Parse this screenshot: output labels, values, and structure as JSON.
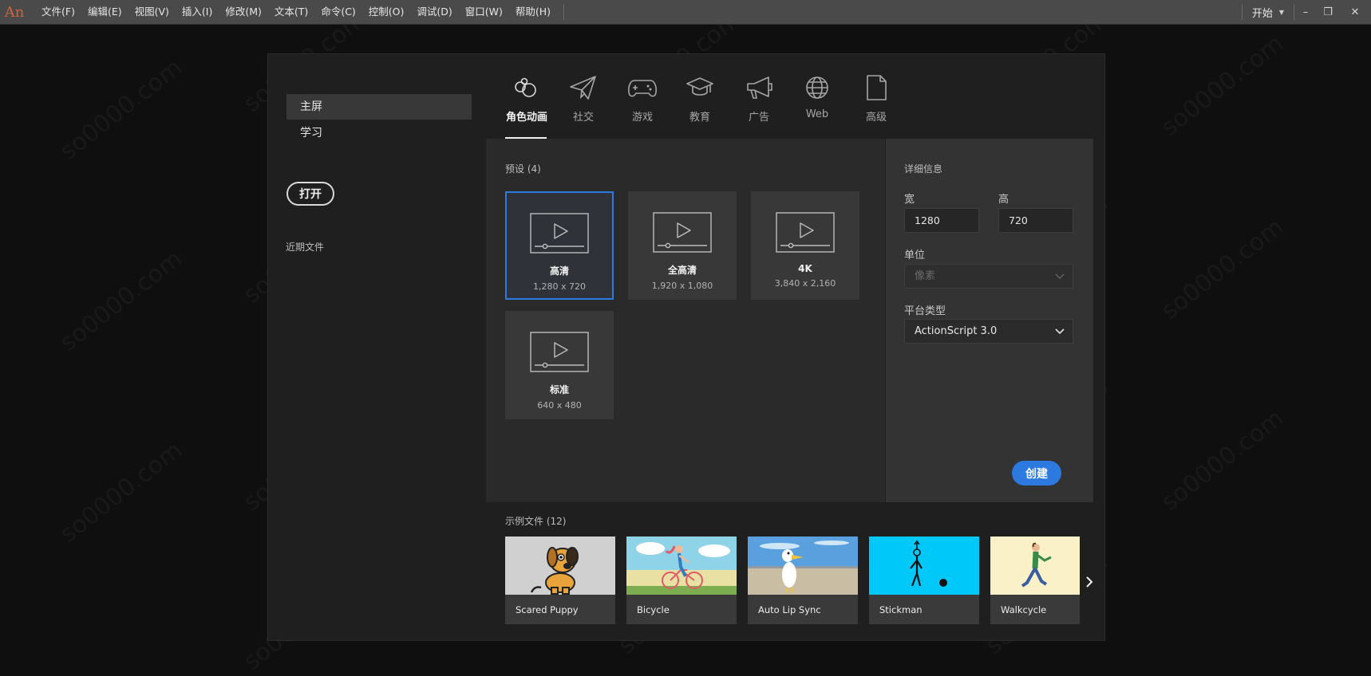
{
  "app": {
    "logo": "An",
    "menu": [
      "文件(F)",
      "编辑(E)",
      "视图(V)",
      "插入(I)",
      "修改(M)",
      "文本(T)",
      "命令(C)",
      "控制(O)",
      "调试(D)",
      "窗口(W)",
      "帮助(H)"
    ],
    "workspace": "开始",
    "window_controls": {
      "minimize": "–",
      "restore": "❐",
      "close": "✕"
    }
  },
  "sidebar": {
    "items": [
      {
        "label": "主屏",
        "active": true
      },
      {
        "label": "学习",
        "active": false
      }
    ],
    "open_button": "打开",
    "recent_title": "近期文件"
  },
  "categories": [
    {
      "label": "角色动画",
      "icon": "character-animation-icon",
      "active": true
    },
    {
      "label": "社交",
      "icon": "paper-plane-icon",
      "active": false
    },
    {
      "label": "游戏",
      "icon": "gamepad-icon",
      "active": false
    },
    {
      "label": "教育",
      "icon": "graduation-cap-icon",
      "active": false
    },
    {
      "label": "广告",
      "icon": "megaphone-icon",
      "active": false
    },
    {
      "label": "Web",
      "icon": "globe-icon",
      "active": false
    },
    {
      "label": "高级",
      "icon": "document-icon",
      "active": false
    }
  ],
  "presets": {
    "title": "预设 (4)",
    "items": [
      {
        "name": "高清",
        "size": "1,280 x 720",
        "selected": true
      },
      {
        "name": "全高清",
        "size": "1,920 x 1,080",
        "selected": false
      },
      {
        "name": "4K",
        "size": "3,840 x 2,160",
        "selected": false
      },
      {
        "name": "标准",
        "size": "640 x 480",
        "selected": false
      }
    ]
  },
  "details": {
    "title": "详细信息",
    "width_label": "宽",
    "width_value": "1280",
    "height_label": "高",
    "height_value": "720",
    "unit_label": "单位",
    "unit_value": "像素",
    "platform_label": "平台类型",
    "platform_value": "ActionScript 3.0",
    "create_button": "创建"
  },
  "samples": {
    "title": "示例文件 (12)",
    "items": [
      {
        "name": "Scared Puppy",
        "thumb": "puppy"
      },
      {
        "name": "Bicycle",
        "thumb": "bicycle"
      },
      {
        "name": "Auto Lip Sync",
        "thumb": "bird"
      },
      {
        "name": "Stickman",
        "thumb": "stickman"
      },
      {
        "name": "Walkcycle",
        "thumb": "walker"
      }
    ]
  },
  "watermark": "so0000.com",
  "colors": {
    "accent": "#2c7ae0",
    "menubar": "#4a4a4a",
    "dialog": "#1f1f1f",
    "logo": "#d0643c"
  }
}
